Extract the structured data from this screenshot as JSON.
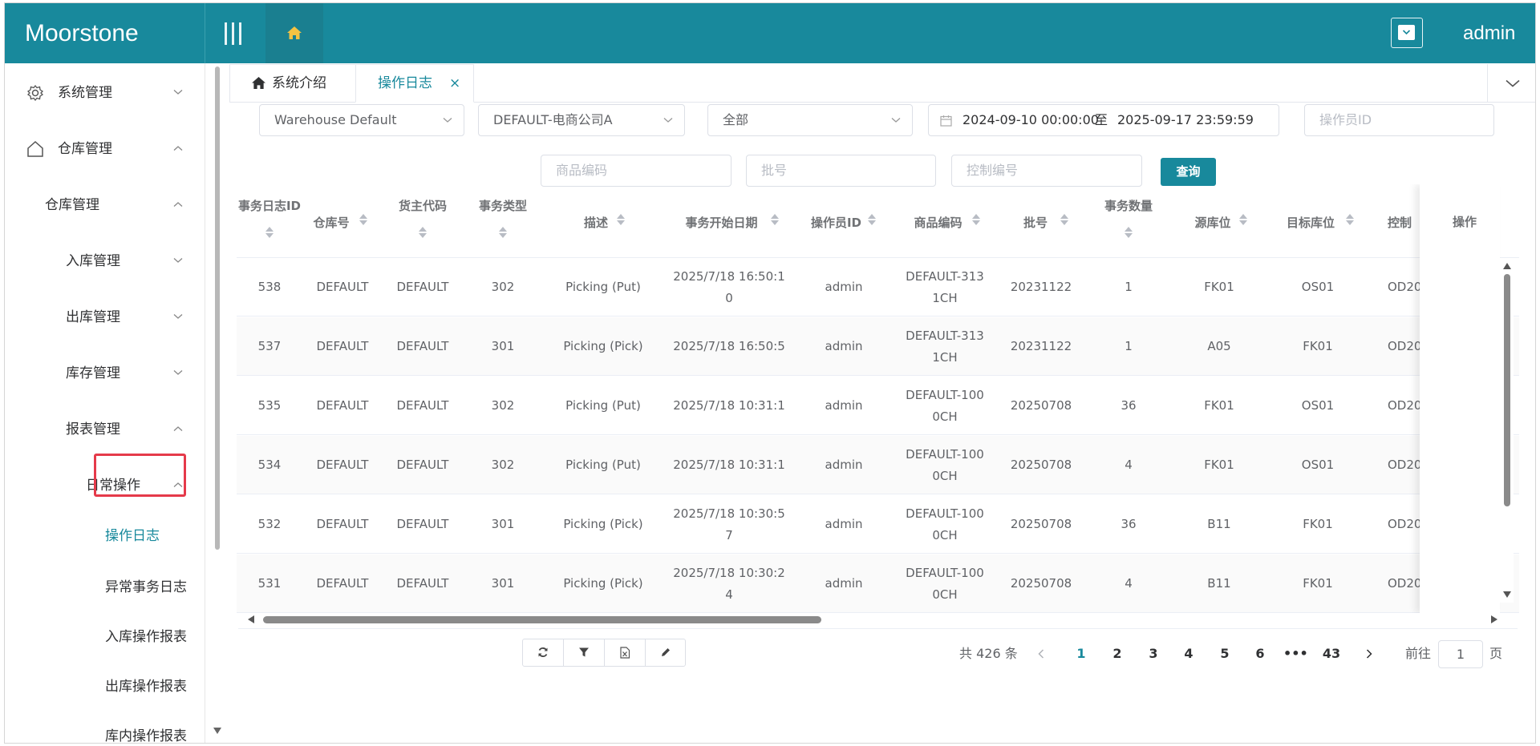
{
  "app": {
    "brand": "Moorstone",
    "user": "admin"
  },
  "colors": {
    "primary": "#18899c",
    "highlight_box": "#e53a4a"
  },
  "sidebar": {
    "items": [
      {
        "label": "系统管理",
        "icon": "gear-icon",
        "expanded": false
      },
      {
        "label": "仓库管理",
        "icon": "home-outline-icon",
        "expanded": true
      },
      {
        "label": "仓库管理",
        "expanded": true
      },
      {
        "label": "入库管理",
        "expanded": false
      },
      {
        "label": "出库管理",
        "expanded": false
      },
      {
        "label": "库存管理",
        "expanded": false
      },
      {
        "label": "报表管理",
        "expanded": true
      },
      {
        "label": "日常操作",
        "expanded": true
      },
      {
        "label": "操作日志",
        "active": true
      },
      {
        "label": "异常事务日志"
      },
      {
        "label": "入库操作报表"
      },
      {
        "label": "出库操作报表"
      },
      {
        "label": "库内操作报表"
      }
    ]
  },
  "tabs": [
    {
      "label": "系统介绍",
      "icon": "home-icon"
    },
    {
      "label": "操作日志",
      "close": "×",
      "active": true
    }
  ],
  "filters": {
    "warehouse": "Warehouse Default",
    "owner": "DEFAULT-电商公司A",
    "type": "全部",
    "date_start": "2024-09-10 00:00:00",
    "date_sep": "至",
    "date_end": "2025-09-17 23:59:59",
    "operator_placeholder": "操作员ID",
    "sku_placeholder": "商品编码",
    "lot_placeholder": "批号",
    "control_placeholder": "控制编号",
    "query_label": "查询"
  },
  "table": {
    "columns": [
      "事务日志ID",
      "仓库号",
      "货主代码",
      "事务类型",
      "描述",
      "事务开始日期",
      "操作员ID",
      "商品编码",
      "批号",
      "事务数量",
      "源库位",
      "目标库位",
      "控制",
      "操作"
    ],
    "rows": [
      [
        "538",
        "DEFAULT",
        "DEFAULT",
        "302",
        "Picking (Put)",
        "2025/7/18 16:50:1\n0",
        "admin",
        "DEFAULT-313\n1CH",
        "20231122",
        "1",
        "FK01",
        "OS01",
        "OD20"
      ],
      [
        "537",
        "DEFAULT",
        "DEFAULT",
        "301",
        "Picking (Pick)",
        "2025/7/18 16:50:5",
        "admin",
        "DEFAULT-313\n1CH",
        "20231122",
        "1",
        "A05",
        "FK01",
        "OD20"
      ],
      [
        "535",
        "DEFAULT",
        "DEFAULT",
        "302",
        "Picking (Put)",
        "2025/7/18 10:31:1",
        "admin",
        "DEFAULT-100\n0CH",
        "20250708",
        "36",
        "FK01",
        "OS01",
        "OD20"
      ],
      [
        "534",
        "DEFAULT",
        "DEFAULT",
        "302",
        "Picking (Put)",
        "2025/7/18 10:31:1",
        "admin",
        "DEFAULT-100\n0CH",
        "20250708",
        "4",
        "FK01",
        "OS01",
        "OD20"
      ],
      [
        "532",
        "DEFAULT",
        "DEFAULT",
        "301",
        "Picking (Pick)",
        "2025/7/18 10:30:5\n7",
        "admin",
        "DEFAULT-100\n0CH",
        "20250708",
        "36",
        "B11",
        "FK01",
        "OD20"
      ],
      [
        "531",
        "DEFAULT",
        "DEFAULT",
        "301",
        "Picking (Pick)",
        "2025/7/18 10:30:2\n4",
        "admin",
        "DEFAULT-100\n0CH",
        "20250708",
        "4",
        "B11",
        "FK01",
        "OD20"
      ]
    ]
  },
  "toolbar": {
    "icons": [
      "refresh-icon",
      "filter-icon",
      "excel-export-icon",
      "edit-icon"
    ]
  },
  "pagination": {
    "total": "共 426 条",
    "pages": [
      "1",
      "2",
      "3",
      "4",
      "5",
      "6",
      "•••",
      "43"
    ],
    "current": "1",
    "goto_label": "前往",
    "goto_value": "1",
    "page_suffix": "页"
  }
}
